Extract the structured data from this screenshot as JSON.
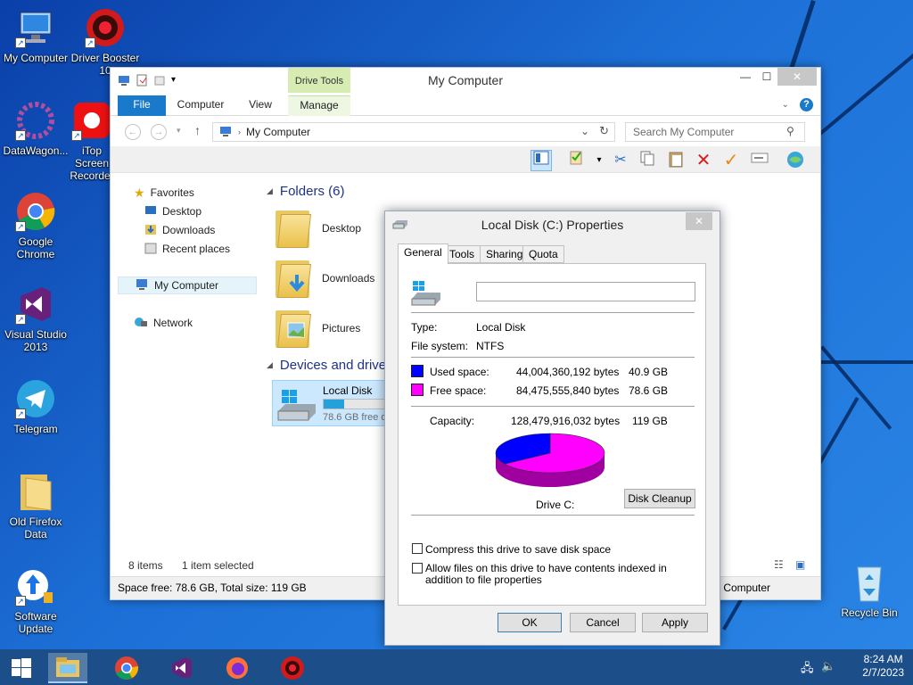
{
  "desktop": {
    "icons": [
      {
        "label": "My Computer"
      },
      {
        "label": "Driver Booster 10"
      },
      {
        "label": "DataWagon..."
      },
      {
        "label": "iTop Screen Recorder"
      },
      {
        "label": "Google Chrome"
      },
      {
        "label": "Visual Studio 2013"
      },
      {
        "label": "Telegram"
      },
      {
        "label": "Old Firefox Data"
      },
      {
        "label": "Software Update"
      },
      {
        "label": "Recycle Bin"
      }
    ]
  },
  "explorer": {
    "title": "My Computer",
    "drive_tools": "Drive Tools",
    "tabs": {
      "file": "File",
      "computer": "Computer",
      "view": "View",
      "manage": "Manage"
    },
    "address": "My Computer",
    "search_placeholder": "Search My Computer",
    "nav": {
      "favorites": "Favorites",
      "desktop": "Desktop",
      "downloads": "Downloads",
      "recent": "Recent places",
      "my_computer": "My Computer",
      "network": "Network"
    },
    "folders_header": "Folders (6)",
    "folders": [
      "Desktop",
      "Downloads",
      "Pictures"
    ],
    "devices_header": "Devices and drives",
    "drive": {
      "name": "Local Disk (C:)",
      "free": "78.6 GB free of 119 GB",
      "used_fraction": 0.34
    },
    "status": {
      "items": "8 items",
      "selected": "1 item selected"
    },
    "info": "Space free: 78.6 GB, Total size: 119 GB",
    "info_right": "My Computer"
  },
  "dialog": {
    "title": "Local Disk (C:) Properties",
    "close": "✕",
    "tabs": [
      "General",
      "Tools",
      "Sharing",
      "Quota"
    ],
    "volume_label": "",
    "type_label": "Type:",
    "type_value": "Local Disk",
    "fs_label": "File system:",
    "fs_value": "NTFS",
    "used_label": "Used space:",
    "used_bytes": "44,004,360,192 bytes",
    "used_gb": "40.9 GB",
    "free_label": "Free space:",
    "free_bytes": "84,475,555,840 bytes",
    "free_gb": "78.6 GB",
    "capacity_label": "Capacity:",
    "capacity_bytes": "128,479,916,032 bytes",
    "capacity_gb": "119 GB",
    "drive_caption": "Drive C:",
    "cleanup": "Disk Cleanup",
    "compress": "Compress this drive to save disk space",
    "index": "Allow files on this drive to have contents indexed in addition to file properties",
    "ok": "OK",
    "cancel": "Cancel",
    "apply": "Apply",
    "colors": {
      "used": "#0000ff",
      "free": "#ff00ff"
    }
  },
  "taskbar": {
    "time": "8:24 AM",
    "date": "2/7/2023"
  }
}
